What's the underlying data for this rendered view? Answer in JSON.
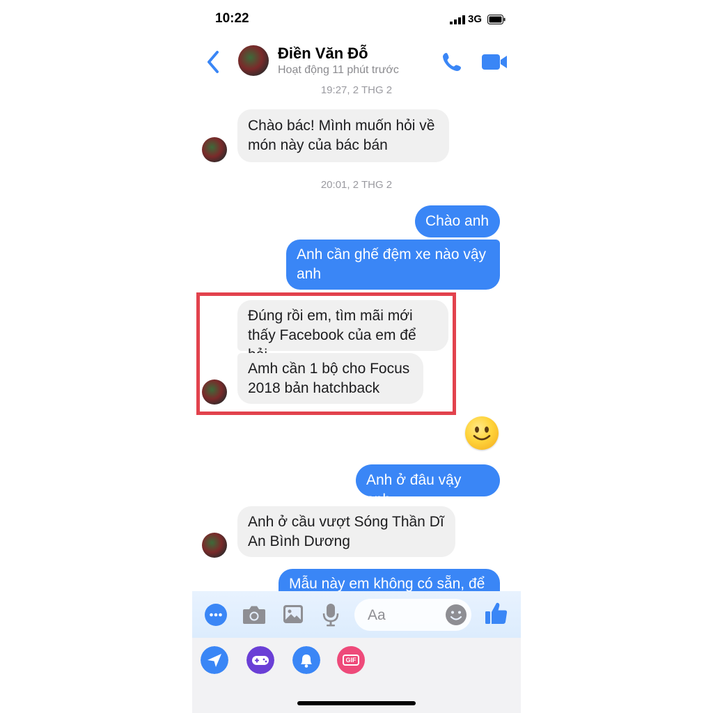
{
  "status_bar": {
    "time": "10:22",
    "network": "3G"
  },
  "header": {
    "contact_name": "Điền Văn Đỗ",
    "contact_status": "Hoạt động 11 phút trước"
  },
  "timestamps": [
    "19:27, 2 THG 2",
    "20:01, 2 THG 2"
  ],
  "messages": [
    {
      "from": "them",
      "lines": [
        "Chào bác! Mình muốn hỏi về",
        "món này của bác bán"
      ]
    },
    {
      "from": "me",
      "lines": [
        "Chào anh"
      ]
    },
    {
      "from": "me",
      "lines": [
        "Anh cần ghế đệm xe nào vậy",
        "anh"
      ]
    },
    {
      "from": "them",
      "lines": [
        "Đúng rồi em, tìm mãi mới",
        "thấy Facebook của em để hỏi"
      ]
    },
    {
      "from": "them",
      "lines": [
        "Amh cần 1 bộ cho Focus",
        "2018 bản hatchback"
      ]
    },
    {
      "from": "me",
      "lines": [
        "Anh ở đâu vậy anh"
      ]
    },
    {
      "from": "them",
      "lines": [
        "Anh ở cầu vượt Sóng Thần Dĩ",
        "An Bình Dương"
      ]
    },
    {
      "from": "me",
      "lines": [
        "Mẫu này em không có sẵn, để"
      ]
    }
  ],
  "composer": {
    "placeholder": "Aa",
    "gif_label": "GIF"
  },
  "icons": {
    "more": "more-icon",
    "camera": "camera-icon",
    "gallery": "gallery-icon",
    "mic": "mic-icon",
    "emoji": "emoji-icon",
    "like": "thumbs-up-icon",
    "send_location": "send-icon",
    "games": "game-controller-icon",
    "notifications": "bell-icon",
    "gif": "gif-icon",
    "call": "phone-icon",
    "video": "video-camera-icon",
    "back": "back-chevron-icon",
    "reaction": "smiley-emoji-icon"
  },
  "colors": {
    "accent": "#3a86f6",
    "highlight_border": "#e2424d",
    "incoming_bubble": "#f0f0f0"
  }
}
